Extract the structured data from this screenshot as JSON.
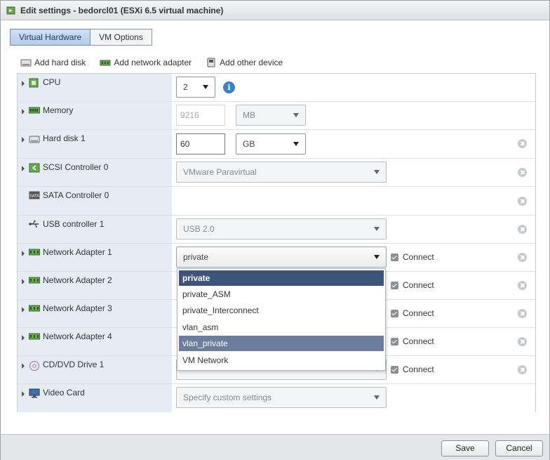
{
  "dialog": {
    "title": "Edit settings - bedorcl01 (ESXi 6.5 virtual machine)"
  },
  "tabs": [
    {
      "label": "Virtual Hardware",
      "active": true
    },
    {
      "label": "VM Options",
      "active": false
    }
  ],
  "toolbar": {
    "add_hard_disk": "Add hard disk",
    "add_network_adapter": "Add network adapter",
    "add_other_device": "Add other device"
  },
  "rows": {
    "cpu": {
      "label": "CPU",
      "value": "2"
    },
    "memory": {
      "label": "Memory",
      "placeholder": "9216",
      "unit": "MB"
    },
    "hard_disk": {
      "label": "Hard disk 1",
      "value": "60",
      "unit": "GB"
    },
    "scsi": {
      "label": "SCSI Controller 0",
      "value": "VMware Paravirtual"
    },
    "sata": {
      "label": "SATA Controller 0"
    },
    "usb": {
      "label": "USB controller 1",
      "value": "USB 2.0"
    },
    "net1": {
      "label": "Network Adapter 1",
      "value": "private",
      "connect": "Connect"
    },
    "net2": {
      "label": "Network Adapter 2",
      "connect": "Connect"
    },
    "net3": {
      "label": "Network Adapter 3",
      "connect": "Connect"
    },
    "net4": {
      "label": "Network Adapter 4",
      "connect": "Connect"
    },
    "cdrom": {
      "label": "CD/DVD Drive 1",
      "connect": "Connect"
    },
    "video": {
      "label": "Video Card",
      "value": "Specify custom settings"
    }
  },
  "network_dropdown": {
    "options": [
      "private",
      "private_ASM",
      "private_Interconnect",
      "vlan_asm",
      "vlan_private",
      "VM Network"
    ],
    "selected": "private",
    "highlighted": "vlan_private"
  },
  "footer": {
    "save": "Save",
    "cancel": "Cancel"
  },
  "colors": {
    "accent": "#3e5478",
    "tab_active": "#b4cde8",
    "row_label_bg": "#e6ecf4",
    "info": "#3a83c7"
  }
}
